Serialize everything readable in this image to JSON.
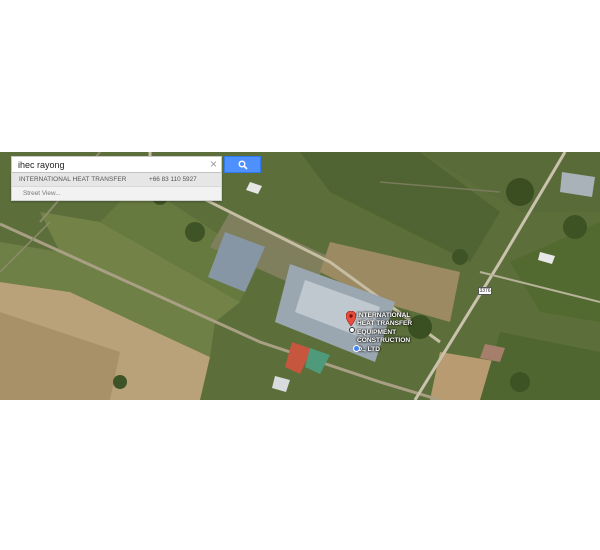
{
  "search": {
    "query": "ihec rayong",
    "clear_glyph": "×",
    "button_icon": "search-icon"
  },
  "results": [
    {
      "name": "INTERNATIONAL HEAT TRANSFER",
      "phone": "+66 83 110 5927"
    }
  ],
  "street_view_label": "Street View...",
  "marker": {
    "label_lines": [
      "INTERNATIONAL",
      "HEAT TRANSFER",
      "EQUIPMENT",
      "CONSTRUCTION",
      "O., LTD"
    ],
    "color": "#e74c3c"
  },
  "road_shield": "3376",
  "colors": {
    "accent": "#4d90fe",
    "map_base": "#5b6e3a",
    "location": "#4285f4"
  }
}
